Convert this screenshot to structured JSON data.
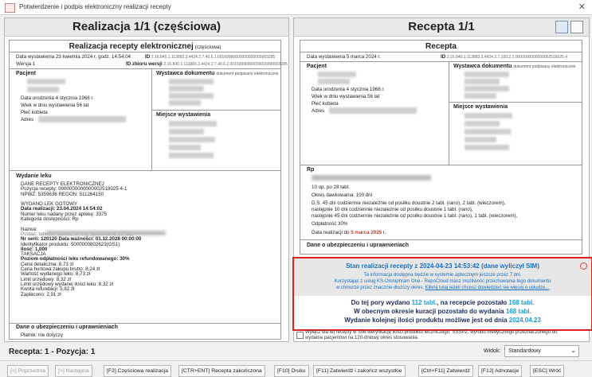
{
  "window": {
    "title": "Potwierdzenie i podpis elektroniczny realizacji recepty",
    "close": "✕"
  },
  "left": {
    "header": "Realizacja 1/1 (częściowa)",
    "doc_title": "Realizacja recepty elektronicznej",
    "doc_title_suffix": "(częściowa)",
    "date_line": "Data wystawienia 23 kwietnia 2024 r. godz. 14:54:04",
    "version": "Wersja 1",
    "id_label": "ID",
    "id_value": "2.16.840.1.113883.3.4424.2.7.40.6.1.00169990000000000000003285",
    "id_set_label": "ID zbioru wersji",
    "id_set_value": "2.16.840.1.113883.3.4424.2.7.40.6.2.00169990000000000000003285",
    "patient": {
      "label": "Pacjent",
      "dob": "Data urodzenia 4 stycznia 1968 r.",
      "age": "Wiek w dniu wystawienia 56 lat",
      "sex": "Płeć kobieta",
      "address": "Adres"
    },
    "issuer": {
      "label": "Wystawca dokumentu",
      "sub": "dokument podpisany elektronicznie",
      "place": "Miejsce wystawienia"
    },
    "dispense_title": "Wydanie leku",
    "dispense_lines": [
      "DANE RECEPTY ELEKTRONICZNEJ",
      "Pozycja recepty: 0000000000000002518025 4-1",
      "NPWZ: 5359636 REGON: 511264150",
      "",
      "WYDANO LEK GOTOWY",
      "Data realizacji: 23.04.2024 14:54:02",
      "Numer leku nadany przez aptekę: 3375",
      "Kategoria dostępności: Rp",
      "",
      "Nazwa:",
      "Postać: tabletki, dawka: 10 mg; opakowanie 28 tabl.",
      "Nr serii: 120120 Data ważności: 01.12.2028 00:00:00",
      "Identyfikator produktu: 5000000802623(GS1)",
      "Ilość: 1,000",
      "TAKSACJA",
      "Poziom odpłatności leku refundowanego: 30%",
      "Cena detaliczna: 8,73 zł",
      "Cena hurtowa zakupu brutto: 8,24 zł",
      "Wartość wydanego leku: 8,73 zł",
      "Limit urzędowy: 8,32 zł",
      "Limit urzędowy wydanej ilości leku: 8,32 zł",
      "Kwota refundacji: 5,82 zł",
      "Zapłacono: 2,91 zł"
    ],
    "safety_title": "Dane o ubezpieczeniu i uprawnieniach",
    "payer": "Płatnik: nie dotyczy"
  },
  "right": {
    "header": "Recepta 1/1",
    "doc_title": "Recepta",
    "date_line": "Data wystawienia 5 marca 2024 r.",
    "id_label": "ID",
    "id_value": "2.16.840.1.113883.3.4424.2.7.100.2.1.0000000000000002518025 4",
    "patient": {
      "label": "Pacjent",
      "dob": "Data urodzenia 4 stycznia 1968 r.",
      "age": "Wiek w dniu wystawienia 56 lat",
      "sex": "Płeć kobieta",
      "address": "Adres"
    },
    "issuer": {
      "label": "Wystawca dokumentu",
      "sub": "dokument podpisany elektronicznie",
      "place": "Miejsce wystawienia"
    },
    "rp_label": "Rp",
    "rp_lines": [
      "10 op. po 28 tabl.",
      "Okres dawkowania: 100 dni",
      "D.S. 45 dni codziennie niezależnie od posiłku doustnie 2 tabl. (rano), 2 tabl. (wieczorem),",
      "następnie 10 dni codziennie niezależnie od posiłku doustnie 1 tabl. (rano),",
      "następnie 45 dni codziennie niezależnie od posiłku doustnie 1 tabl. (rano), 1 tabl. (wieczorem),",
      "Odpłatność 30%"
    ],
    "realization_date_label": "Data realizacji do",
    "realization_date_value": "5 marca 2025 r.",
    "safety_title": "Dane o ubezpieczeniu i uprawnieniach"
  },
  "sim": {
    "title": "Stan realizacji recepty z 2024-04-23 14:53:42 (dane wyliczył SIM)",
    "info1": "Ta informacja dostępna będzie w systemie aptecznym jeszcze przez 7 dni.",
    "info2": "Korzystając z usług KS-Omniphram One - RepoCloud masz możliwość przechowania tego dokumentu",
    "info3_pre": "w chmurze przez znacznie dłuższy okres.",
    "info3_link": "Kliknij tutaj jeżeli chcesz dowiedzieć się więcej o usłudze...",
    "line1_pre": "Do tej pory wydano ",
    "line1_v1": "112 tabl.",
    "line1_mid": ", na recepcie pozostało ",
    "line1_v2": "168 tabl.",
    "line2_pre": "W obecnym okresie kuracji pozostało do wydania ",
    "line2_v": "168 tabl.",
    "line3_pre": "Wydanie kolejnej ilości produktu możliwe jest od dnia ",
    "line3_v": "2024.04.23"
  },
  "checkbox": {
    "label": "Wyłącz dla tej recepty w SIM weryfikację ilości produktu leczniczego, SSSPŻ, wyrobu medycznego przeznaczonego do wydania pacjentowi na 120-dniowy okres stosowania."
  },
  "status": {
    "position": "Recepta: 1 - Pozycja: 1",
    "view_label": "Widok:",
    "view_value": "Standardowy"
  },
  "buttons": [
    "[<] Poprzednia",
    "[>] Następna",
    "[F2] Częściowa realizacja",
    "[CTR+ENT] Recepta zakończona",
    "[F10] Druku",
    "[F11] Zatwierdź i zakończ wszystkie",
    "[Ctrl+F11] Zatwierdź",
    "[F12] Adnotacje",
    "[ESC] Wróć"
  ]
}
